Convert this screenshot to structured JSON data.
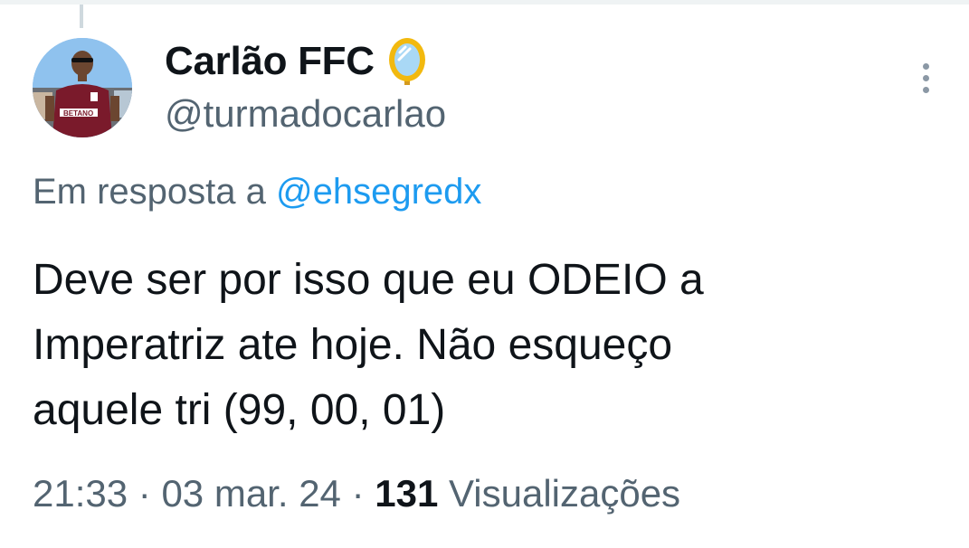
{
  "tweet": {
    "author": {
      "display_name": "Carlão FFC",
      "handle": "@turmadocarlao",
      "badge_icon": "mirror-emoji-icon",
      "avatar_shirt_text": "BETANO"
    },
    "more_icon": "more-vertical-icon",
    "reply": {
      "prefix": "Em resposta a",
      "mention": "@ehsegredx"
    },
    "text_lines": [
      "Deve ser por isso que eu ODEIO a",
      "Imperatriz ate hoje. Não esqueço",
      "aquele tri (99, 00, 01)"
    ],
    "meta": {
      "time": "21:33",
      "separator": "·",
      "date": "03 mar. 24",
      "views_count": "131",
      "views_label": "Visualizações"
    }
  },
  "colors": {
    "primary_text": "#0f1419",
    "secondary_text": "#536471",
    "link": "#1d9bf0",
    "shirt": "#7a1a2b"
  }
}
